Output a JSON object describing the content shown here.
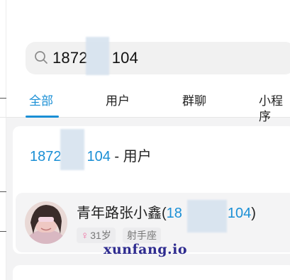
{
  "search": {
    "value_prefix": "1872",
    "value_suffix": "104"
  },
  "tabs": [
    {
      "label": "全部",
      "active": true
    },
    {
      "label": "用户",
      "active": false
    },
    {
      "label": "群聊",
      "active": false
    },
    {
      "label": "小程序",
      "active": false
    }
  ],
  "section": {
    "number_prefix": "1872",
    "number_suffix": "104",
    "separator": " - ",
    "type_label": "用户"
  },
  "result": {
    "name": "青年路张小鑫(",
    "number_prefix": "18",
    "number_suffix": "104",
    "close_paren": ")",
    "gender_icon": "female-symbol-icon",
    "age": "31岁",
    "zodiac": "射手座"
  },
  "watermark": "xunfang.io",
  "colors": {
    "accent": "#1a8fd5",
    "female": "#f06aa0",
    "watermark": "#2e2b8f"
  }
}
